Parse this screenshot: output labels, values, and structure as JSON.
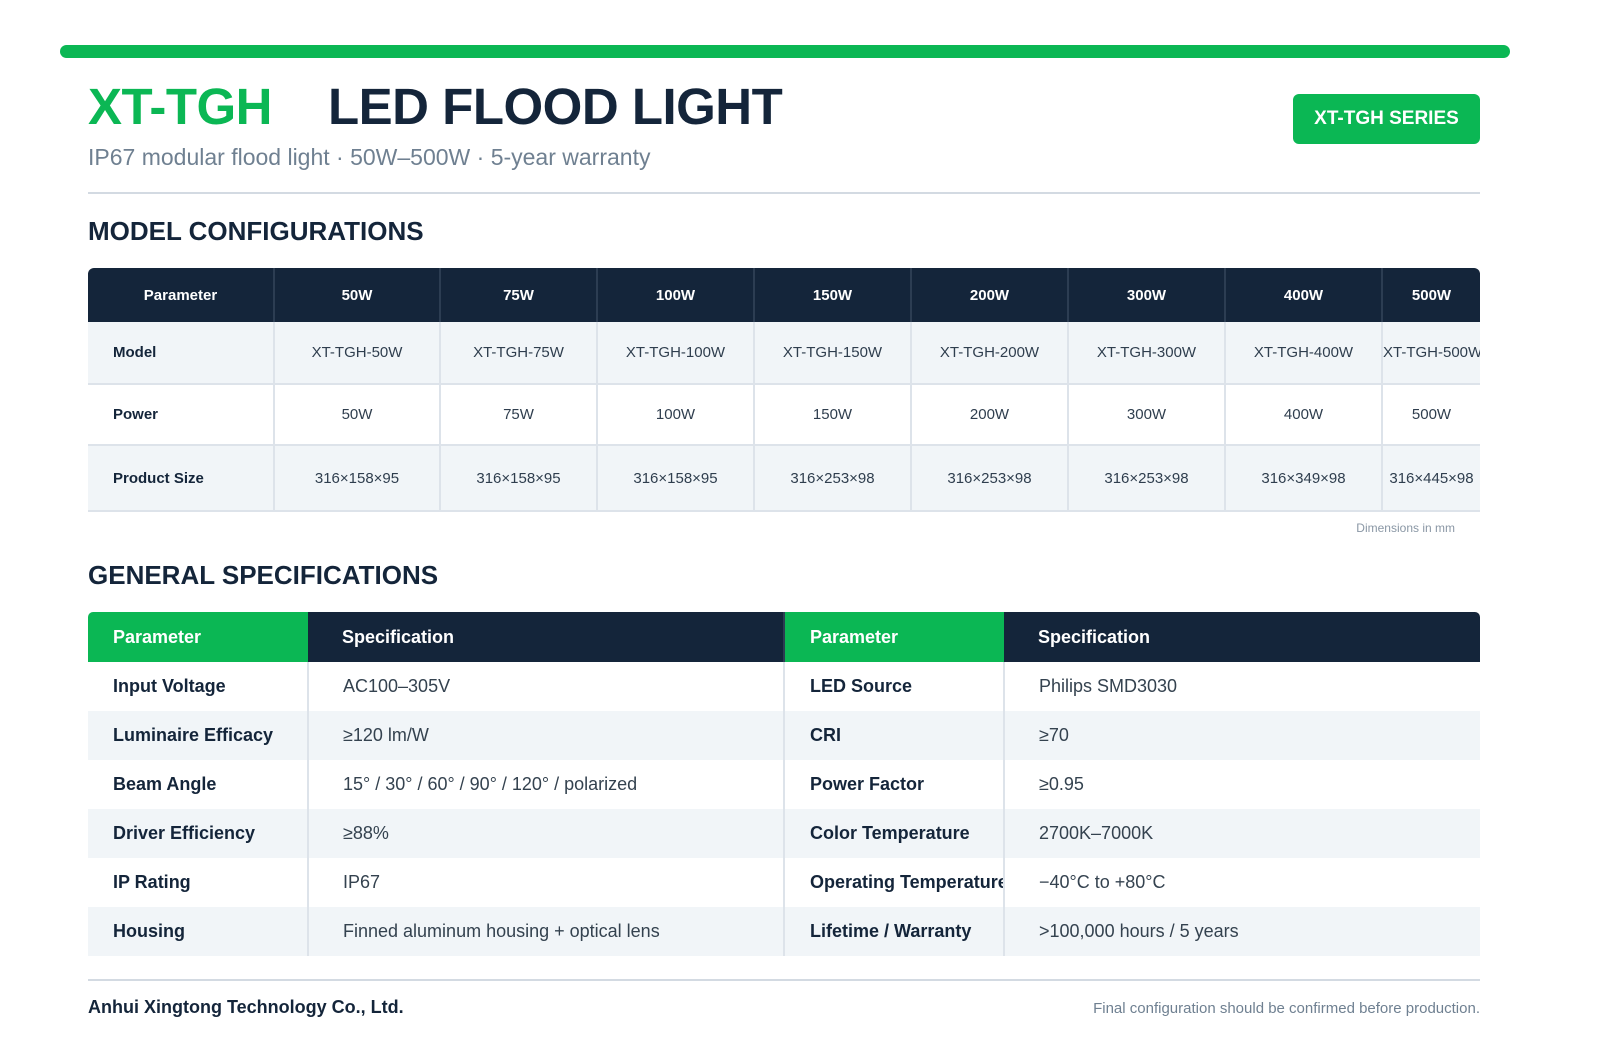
{
  "header": {
    "brand": "XT-TGH",
    "product": "LED FLOOD LIGHT",
    "subtitle": "IP67 modular flood light · 50W–500W · 5-year warranty",
    "badge": "XT-TGH SERIES"
  },
  "colors": {
    "accent": "#0bb754",
    "dark": "#14253a"
  },
  "model_section": {
    "title": "MODEL CONFIGURATIONS",
    "columns": [
      "Parameter",
      "50W",
      "75W",
      "100W",
      "150W",
      "200W",
      "300W",
      "400W",
      "500W"
    ],
    "rows": [
      {
        "label": "Model",
        "values": [
          "XT-TGH-50W",
          "XT-TGH-75W",
          "XT-TGH-100W",
          "XT-TGH-150W",
          "XT-TGH-200W",
          "XT-TGH-300W",
          "XT-TGH-400W",
          "XT-TGH-500W"
        ]
      },
      {
        "label": "Power",
        "values": [
          "50W",
          "75W",
          "100W",
          "150W",
          "200W",
          "300W",
          "400W",
          "500W"
        ]
      },
      {
        "label": "Product Size",
        "values": [
          "316×158×95",
          "316×158×95",
          "316×158×95",
          "316×253×98",
          "316×253×98",
          "316×253×98",
          "316×349×98",
          "316×445×98"
        ]
      }
    ],
    "note": "Dimensions in mm"
  },
  "general_section": {
    "title": "GENERAL SPECIFICATIONS",
    "headers": [
      "Parameter",
      "Specification",
      "Parameter",
      "Specification"
    ],
    "rows": [
      {
        "p1": "Input Voltage",
        "s1": "AC100–305V",
        "p2": "LED Source",
        "s2": "Philips SMD3030"
      },
      {
        "p1": "Luminaire Efficacy",
        "s1": "≥120 lm/W",
        "p2": "CRI",
        "s2": "≥70"
      },
      {
        "p1": "Beam Angle",
        "s1": "15° / 30° / 60° / 90° / 120° / polarized",
        "p2": "Power Factor",
        "s2": "≥0.95"
      },
      {
        "p1": "Driver Efficiency",
        "s1": "≥88%",
        "p2": "Color Temperature",
        "s2": "2700K–7000K"
      },
      {
        "p1": "IP Rating",
        "s1": "IP67",
        "p2": "Operating Temperature",
        "s2": "−40°C to +80°C"
      },
      {
        "p1": "Housing",
        "s1": "Finned aluminum housing + optical lens",
        "p2": "Lifetime / Warranty",
        "s2": ">100,000 hours / 5 years"
      }
    ]
  },
  "footer": {
    "company": "Anhui Xingtong Technology Co., Ltd.",
    "disclaimer": "Final configuration should be confirmed before production."
  }
}
